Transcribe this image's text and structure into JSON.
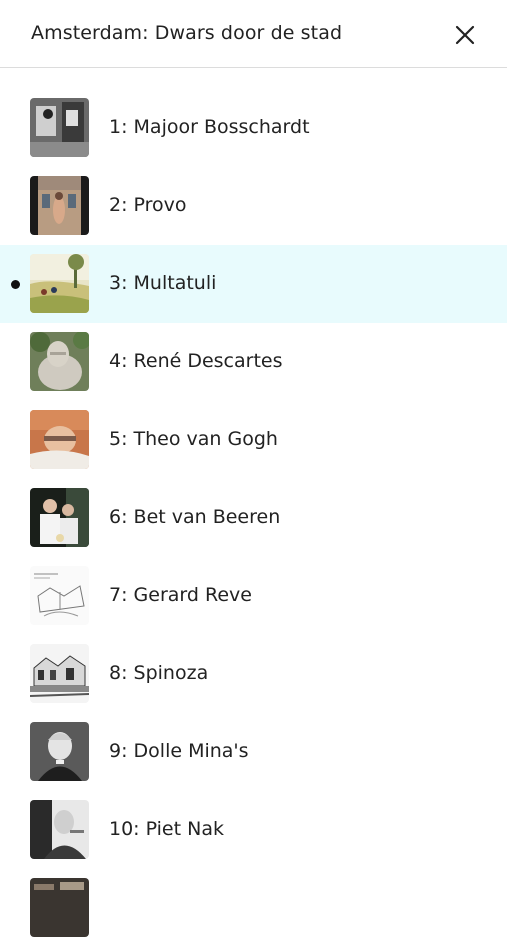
{
  "header": {
    "title": "Amsterdam: Dwars door de stad",
    "close_icon": "close-icon"
  },
  "list": {
    "active_index": 2,
    "active_color": "#e8fbfd",
    "items": [
      {
        "label": "1: Majoor Bosschardt",
        "thumb": "bw-photo"
      },
      {
        "label": "2: Provo",
        "thumb": "color-photo-street"
      },
      {
        "label": "3: Multatuli",
        "thumb": "painting-landscape"
      },
      {
        "label": "4: René Descartes",
        "thumb": "stone-statue"
      },
      {
        "label": "5: Theo van Gogh",
        "thumb": "color-portrait"
      },
      {
        "label": "6: Bet van Beeren",
        "thumb": "color-photo-couple"
      },
      {
        "label": "7: Gerard Reve",
        "thumb": "sketch"
      },
      {
        "label": "8: Spinoza",
        "thumb": "engraving"
      },
      {
        "label": "9: Dolle Mina's",
        "thumb": "bw-portrait"
      },
      {
        "label": "10: Piet Nak",
        "thumb": "bw-portrait-2"
      },
      {
        "label": "",
        "thumb": "partial"
      }
    ]
  }
}
